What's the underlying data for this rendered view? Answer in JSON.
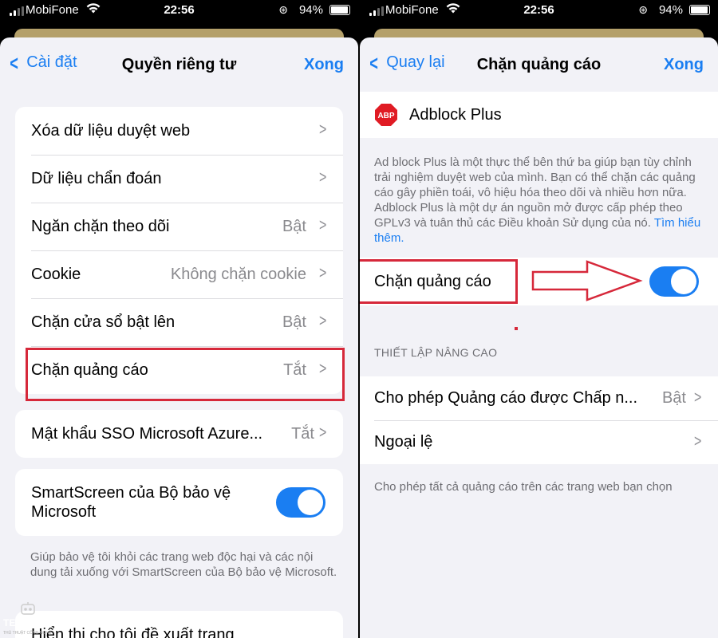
{
  "status": {
    "carrier": "MobiFone",
    "time": "22:56",
    "battery": "94%"
  },
  "left": {
    "nav": {
      "back": "Cài đặt",
      "title": "Quyền riêng tư",
      "done": "Xong"
    },
    "rows": [
      {
        "label": "Xóa dữ liệu duyệt web",
        "value": ""
      },
      {
        "label": "Dữ liệu chẩn đoán",
        "value": ""
      },
      {
        "label": "Ngăn chặn theo dõi",
        "value": "Bật"
      },
      {
        "label": "Cookie",
        "value": "Không chặn cookie"
      },
      {
        "label": "Chặn cửa sổ bật lên",
        "value": "Bật"
      },
      {
        "label": "Chặn quảng cáo",
        "value": "Tắt"
      }
    ],
    "sso": {
      "label": "Mật khẩu SSO Microsoft Azure...",
      "value": "Tắt"
    },
    "smartscreen": {
      "label": "SmartScreen của Bộ bảo vệ Microsoft",
      "on": true
    },
    "smartscreen_note": "Giúp bảo vệ tôi khỏi các trang web độc hại và các nội dung tải xuống với SmartScreen của Bộ bảo vệ Microsoft.",
    "suggest": {
      "label": "Hiển thị cho tôi đề xuất trang"
    }
  },
  "right": {
    "nav": {
      "back": "Quay lại",
      "title": "Chặn quảng cáo",
      "done": "Xong"
    },
    "provider": {
      "name": "Adblock Plus",
      "badge": "ABP"
    },
    "description": "Ad block Plus là một thực thể bên thứ ba giúp bạn tùy chỉnh trải nghiệm duyệt web của mình. Bạn có thể chặn các quảng cáo gây phiền toái, vô hiệu hóa theo dõi và nhiều hơn nữa. Adblock Plus là một dự án nguồn mở được cấp phép theo GPLv3 và tuân thủ các Điều khoản Sử dụng của nó.",
    "learn_more": "Tìm hiểu thêm.",
    "adblock_toggle": {
      "label": "Chặn quảng cáo",
      "on": true
    },
    "advanced_header": "THIẾT LẬP NÂNG CAO",
    "advanced_rows": [
      {
        "label": "Cho phép Quảng cáo được Chấp n...",
        "value": "Bật"
      },
      {
        "label": "Ngoại lệ",
        "value": ""
      }
    ],
    "advanced_note": "Cho phép tất cả quảng cáo trên các trang web bạn chọn"
  },
  "watermark": {
    "line1": "TECH TRICKS",
    "line2": "THỦ THUẬT CÔNG NGHỆ"
  },
  "colors": {
    "accent": "#1a7ef2",
    "highlight": "#d6283a",
    "abp_red": "#e01b24"
  }
}
